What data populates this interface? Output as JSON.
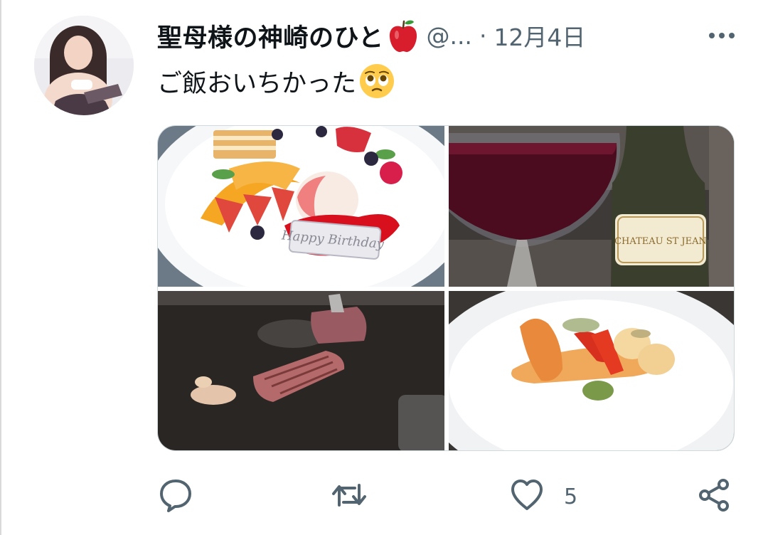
{
  "tweet": {
    "author": {
      "display_name": "聖母様の神崎のひと",
      "name_emoji": "apple-icon",
      "handle": "@...",
      "separator": "·",
      "date": "12月4日"
    },
    "text": "ご飯おいちかった",
    "text_emoji": "pleading-face-emoji",
    "media": [
      {
        "name": "birthday-dessert-plate-photo",
        "plaque_text": "Happy Birthday"
      },
      {
        "name": "red-wine-glass-and-bottle-photo",
        "label_text": "CHATEAU ST JEAN"
      },
      {
        "name": "teppanyaki-steak-photo"
      },
      {
        "name": "seafood-plate-photo"
      }
    ],
    "actions": {
      "reply_icon": "reply-icon",
      "retweet_icon": "retweet-icon",
      "like_icon": "heart-icon",
      "like_count": "5",
      "share_icon": "share-icon"
    }
  },
  "colors": {
    "text_primary": "#0f1419",
    "text_secondary": "#536471",
    "border": "#cfd9de"
  }
}
